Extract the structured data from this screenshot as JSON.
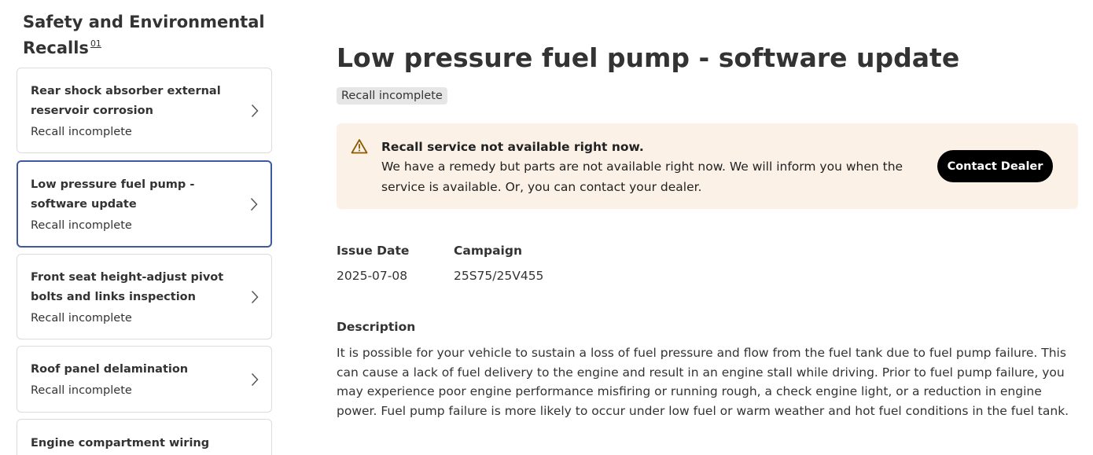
{
  "sidebar": {
    "title": "Safety and Environmental Recalls",
    "title_sup": "01",
    "recalls": [
      {
        "title": "Rear shock absorber external reservoir corrosion",
        "status": "Recall incomplete"
      },
      {
        "title": "Low pressure fuel pump - software update",
        "status": "Recall incomplete"
      },
      {
        "title": "Front seat height-adjust pivot bolts and links inspection",
        "status": "Recall incomplete"
      },
      {
        "title": "Roof panel delamination",
        "status": "Recall incomplete"
      },
      {
        "title": "Engine compartment wiring harness",
        "status": ""
      }
    ]
  },
  "main": {
    "title": "Low pressure fuel pump - software update",
    "status": "Recall incomplete",
    "alert": {
      "icon": "warning-triangle-icon",
      "heading": "Recall service not available right now.",
      "body": "We have a remedy but parts are not available right now. We will inform you when the service is available. Or, you can contact your dealer.",
      "button_label": "Contact Dealer"
    },
    "issue_date_label": "Issue Date",
    "issue_date": "2025-07-08",
    "campaign_label": "Campaign",
    "campaign": "25S75/25V455",
    "description_label": "Description",
    "description": "It is possible for your vehicle to sustain a loss of fuel pressure and flow from the fuel tank due to fuel pump failure. This can cause a lack of fuel delivery to the engine and result in an engine stall while driving. Prior to fuel pump failure, you may experience poor engine performance misfiring or running rough, a check engine light, or a reduction in engine power. Fuel pump failure is more likely to occur under low fuel or warm weather and hot fuel conditions in the fuel tank."
  },
  "colors": {
    "selected_border": "#3d5a9e",
    "alert_background": "#fbf1e7",
    "warning_icon": "#8a5a00",
    "badge_background": "#e6e6e6",
    "button_background": "#000000"
  }
}
